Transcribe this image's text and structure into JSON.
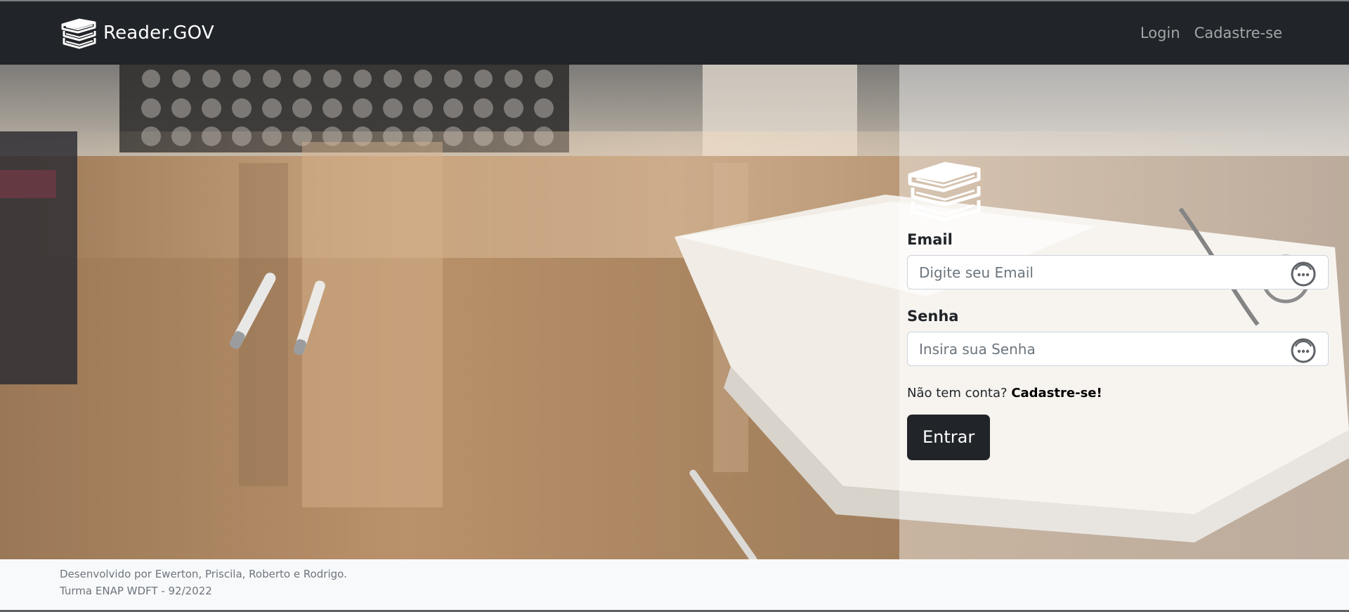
{
  "navbar": {
    "brand_icon": "books-stack-icon",
    "brand": "Reader.GOV",
    "links": [
      {
        "label": "Login"
      },
      {
        "label": "Cadastre-se"
      }
    ]
  },
  "login_form": {
    "icon": "books-stack-icon",
    "email": {
      "label": "Email",
      "placeholder": "Digite seu Email",
      "value": "",
      "autofill_icon": "password-manager-icon"
    },
    "password": {
      "label": "Senha",
      "placeholder": "Insira sua Senha",
      "value": "",
      "autofill_icon": "password-manager-icon"
    },
    "signup_prompt": "Não tem conta?",
    "signup_link": "Cadastre-se!",
    "submit_label": "Entrar"
  },
  "footer": {
    "line1": "Desenvolvido por Ewerton, Priscila, Roberto e Rodrigo.",
    "line2": "Turma ENAP WDFT - 92/2022"
  },
  "colors": {
    "navbar_bg": "#212529",
    "nav_link": "#a3a6a9",
    "button_bg": "#212529",
    "footer_bg": "#f8f9fa",
    "footer_text": "#6c757d"
  }
}
